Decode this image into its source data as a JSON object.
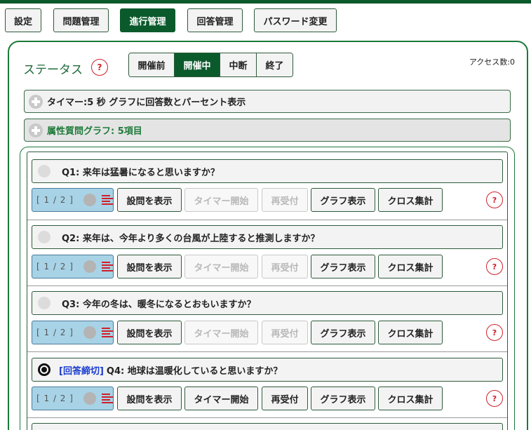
{
  "nav": {
    "items": [
      {
        "label": "設定",
        "active": false
      },
      {
        "label": "問題管理",
        "active": false
      },
      {
        "label": "進行管理",
        "active": true
      },
      {
        "label": "回答管理",
        "active": false
      },
      {
        "label": "パスワード変更",
        "active": false
      }
    ]
  },
  "status": {
    "label": "ステータス",
    "help": "?",
    "options": [
      {
        "label": "開催前",
        "active": false
      },
      {
        "label": "開催中",
        "active": true
      },
      {
        "label": "中断",
        "active": false
      },
      {
        "label": "終了",
        "active": false
      }
    ]
  },
  "access": {
    "text": "アクセス数:0"
  },
  "accordions": [
    {
      "label": "タイマー:5 秒 グラフに回答数とパーセント表示"
    },
    {
      "label": "属性質問グラフ: 5項目"
    }
  ],
  "actions": {
    "show": "設問を表示",
    "timer": "タイマー開始",
    "reopen": "再受付",
    "graph": "グラフ表示",
    "cross": "クロス集計",
    "help": "?"
  },
  "questions": [
    {
      "text": "Q1: 来年は猛暑になると思いますか？",
      "closed_label": "",
      "counter": "[ 1 / 2 ]",
      "selected": false,
      "timer_disabled": true,
      "reopen_disabled": true
    },
    {
      "text": "Q2: 来年は、今年より多くの台風が上陸すると推測しますか？",
      "closed_label": "",
      "counter": "[ 1 / 2 ]",
      "selected": false,
      "timer_disabled": true,
      "reopen_disabled": true
    },
    {
      "text": "Q3: 今年の冬は、暖冬になるとおもいますか？",
      "closed_label": "",
      "counter": "[ 1 / 2 ]",
      "selected": false,
      "timer_disabled": true,
      "reopen_disabled": true
    },
    {
      "text": "Q4: 地球は温暖化していると思いますか？",
      "closed_label": "[回答締切]",
      "counter": "[ 1 / 2 ]",
      "selected": true,
      "timer_disabled": false,
      "reopen_disabled": false
    }
  ],
  "colors": {
    "brand": "#0b5a2c",
    "accent_green": "#1f7a3a",
    "help_red": "#d0202a",
    "counter_bg": "#a8d3e6",
    "closed_blue": "#1a3cd0"
  }
}
